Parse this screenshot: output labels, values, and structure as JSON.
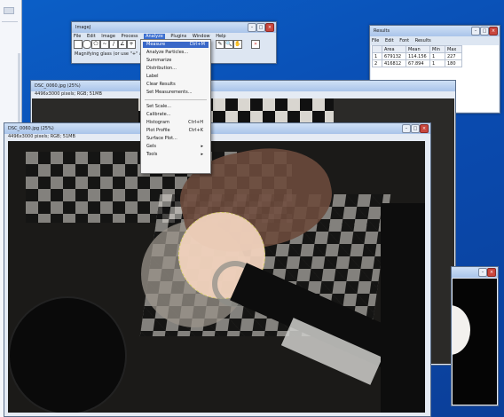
{
  "imagej": {
    "title": "ImageJ",
    "menu": [
      "File",
      "Edit",
      "Image",
      "Process",
      "Analyze",
      "Plugins",
      "Window",
      "Help"
    ],
    "active_menu": "Analyze",
    "status": "Magnifying glass (or use \"+\" and \"-\")"
  },
  "analyze_menu": {
    "items": [
      {
        "label": "Measure",
        "shortcut": "Ctrl+M",
        "highlight": true
      },
      {
        "label": "Analyze Particles...",
        "shortcut": ""
      },
      {
        "label": "Summarize",
        "shortcut": ""
      },
      {
        "label": "Distribution...",
        "shortcut": ""
      },
      {
        "label": "Label",
        "shortcut": ""
      },
      {
        "label": "Clear Results",
        "shortcut": ""
      },
      {
        "label": "Set Measurements...",
        "shortcut": ""
      },
      {
        "label": "Set Scale...",
        "shortcut": ""
      },
      {
        "label": "Calibrate...",
        "shortcut": ""
      },
      {
        "label": "Histogram",
        "shortcut": "Ctrl+H"
      },
      {
        "label": "Plot Profile",
        "shortcut": "Ctrl+K"
      },
      {
        "label": "Surface Plot...",
        "shortcut": ""
      },
      {
        "label": "Gels",
        "shortcut": "▸"
      },
      {
        "label": "Tools",
        "shortcut": "▸"
      }
    ]
  },
  "results": {
    "title": "Results",
    "menu": [
      "File",
      "Edit",
      "Font",
      "Results"
    ],
    "columns": [
      "",
      "Area",
      "Mean",
      "Min",
      "Max"
    ],
    "rows": [
      [
        "1",
        "679132",
        "114.156",
        "1",
        "227"
      ],
      [
        "2",
        "416812",
        "67.894",
        "1",
        "180"
      ]
    ]
  },
  "back_image": {
    "title": "DSC_0060.jpg (25%)",
    "info": "4496x3000 pixels; RGB; 51MB"
  },
  "front_image": {
    "title": "DSC_0060.jpg (25%)",
    "info": "4496x3000 pixels; RGB; 51MB"
  },
  "colors": {
    "accent": "#3a68c8",
    "desktop": "#0a4bb0"
  }
}
